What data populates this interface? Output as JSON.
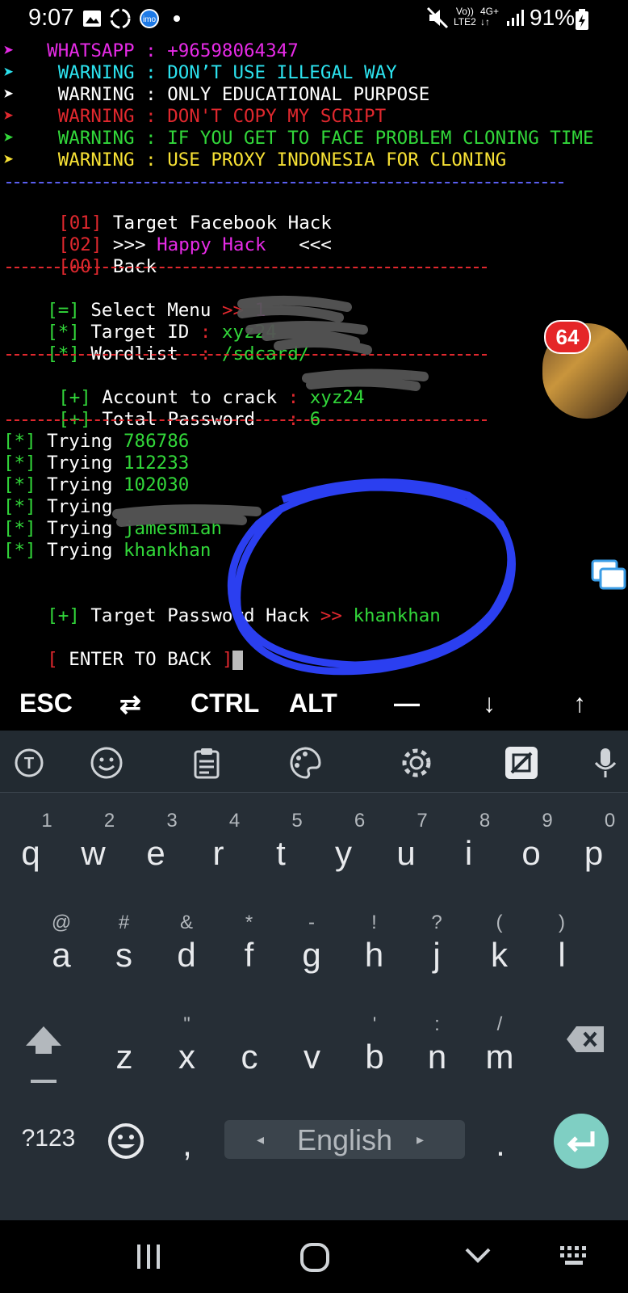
{
  "status_bar": {
    "time": "9:07",
    "lte_top": "Vo))",
    "lte_bottom": "LTE2",
    "net": "4G+",
    "battery": "91%",
    "imo": "imo"
  },
  "terminal": {
    "warnings": [
      {
        "arrow": "➤",
        "text": "   WHATSAPP : +96598064347",
        "color": "#e72be7",
        "arrow_color": "#e72be7"
      },
      {
        "arrow": "➤",
        "text": "    WARNING : DON’T USE ILLEGAL WAY",
        "color": "#2ce2ee",
        "arrow_color": "#2ce2ee"
      },
      {
        "arrow": "➤",
        "text": "    WARNING : ONLY EDUCATIONAL PURPOSE",
        "color": "#ffffff",
        "arrow_color": "#ffffff"
      },
      {
        "arrow": "➤",
        "text": "    WARNING : DON'T COPY MY SCRIPT",
        "color": "#e0282e",
        "arrow_color": "#e0282e"
      },
      {
        "arrow": "➤",
        "text": "    WARNING : IF YOU GET TO FACE PROBLEM CLONING TIME",
        "color": "#32d73a",
        "arrow_color": "#32d73a"
      },
      {
        "arrow": "➤",
        "text": "    WARNING : USE PROXY INDONESIA FOR CLONING",
        "color": "#f7e135",
        "arrow_color": "#f7e135"
      }
    ],
    "menu": [
      {
        "num": "[01]",
        "label": " Target Facebook Hack",
        "extra": "",
        "tail": ""
      },
      {
        "num": "[02]",
        "label": " >>> ",
        "extra": "Happy Hack",
        "tail": "   <<<"
      },
      {
        "num": "[00]",
        "label": " Back",
        "extra": "",
        "tail": ""
      }
    ],
    "select_menu": {
      "tag": "[=]",
      "label": " Select Menu ",
      "arrow": ">>",
      "value": " 1"
    },
    "target_id": {
      "tag": "[*]",
      "label": " Target ID ",
      "colon": ":",
      "value": " xyz24"
    },
    "wordlist": {
      "tag": "[*]",
      "label": " Wordlist  ",
      "colon": ":",
      "value": " /sdcard/"
    },
    "account": {
      "tag": "[+]",
      "label": " Account to crack ",
      "colon": ":",
      "value": " xyz24"
    },
    "total": {
      "tag": "[+]",
      "label": " Total Password  ",
      "colon": " :",
      "value": " 6"
    },
    "trying_label": " Trying ",
    "tries": [
      "786786",
      "112233",
      "102030",
      "",
      "jamesmiah",
      "khankhan"
    ],
    "result": {
      "tag": "[+]",
      "label": " Target Password Hack ",
      "arrow": ">>",
      "value": " khankhan"
    },
    "enter_back": {
      "open": "[",
      "label": " ENTER TO BACK ",
      "close": "]"
    }
  },
  "extra_keys": [
    "ESC",
    "⇄",
    "CTRL",
    "ALT",
    "—",
    "↓",
    "↑"
  ],
  "bubble": {
    "badge": "64"
  },
  "keyboard": {
    "row1": [
      [
        "q",
        "1"
      ],
      [
        "w",
        "2"
      ],
      [
        "e",
        "3"
      ],
      [
        "r",
        "4"
      ],
      [
        "t",
        "5"
      ],
      [
        "y",
        "6"
      ],
      [
        "u",
        "7"
      ],
      [
        "i",
        "8"
      ],
      [
        "o",
        "9"
      ],
      [
        "p",
        "0"
      ]
    ],
    "row2": [
      [
        "a",
        "@"
      ],
      [
        "s",
        "#"
      ],
      [
        "d",
        "&"
      ],
      [
        "f",
        "*"
      ],
      [
        "g",
        "-"
      ],
      [
        "h",
        "!"
      ],
      [
        "j",
        "?"
      ],
      [
        "k",
        "("
      ],
      [
        "l",
        ")"
      ]
    ],
    "row3": [
      [
        "z",
        ""
      ],
      [
        "x",
        "\""
      ],
      [
        "c",
        ""
      ],
      [
        "v",
        ""
      ],
      [
        "b",
        "'"
      ],
      [
        "n",
        ":"
      ],
      [
        "m",
        "/"
      ]
    ],
    "symbols": "?123",
    "comma": ",",
    "period": ".",
    "space": "English",
    "space_left": "◂",
    "space_right": "▸"
  },
  "colors": {
    "green": "#32d73a",
    "red": "#e0282e",
    "magenta": "#e72be7",
    "cyan": "#2ce2ee",
    "yellow": "#f7e135",
    "blue_ink": "#2b3ff0",
    "enter_key": "#7fcfc3"
  }
}
